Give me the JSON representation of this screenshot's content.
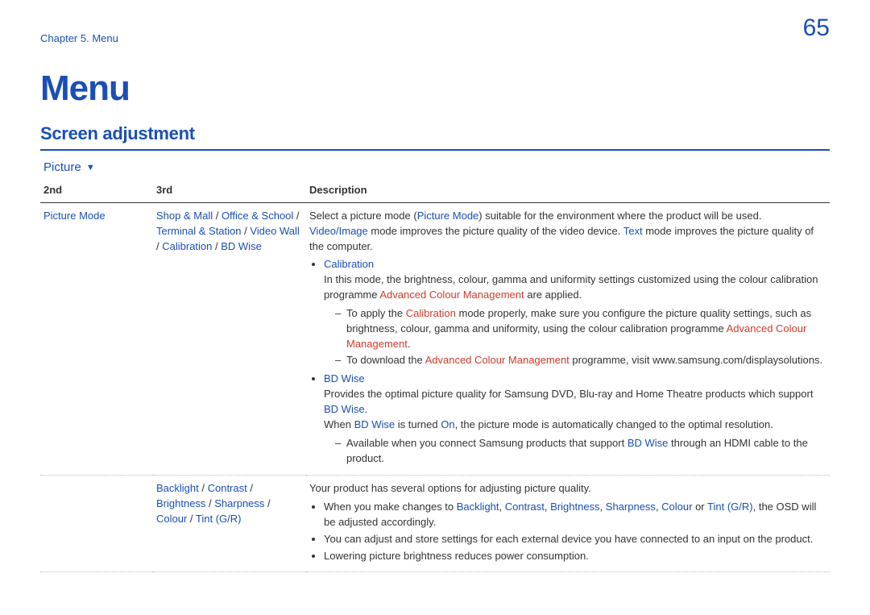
{
  "header": {
    "chapter": "Chapter 5. Menu",
    "page_number": "65"
  },
  "title": "Menu",
  "section": "Screen adjustment",
  "dropdown": "Picture",
  "table": {
    "headers": {
      "c1": "2nd",
      "c2": "3rd",
      "c3": "Description"
    }
  },
  "row1": {
    "c1": "Picture Mode",
    "c2": {
      "opt1": "Shop & Mall",
      "opt2": "Office & School",
      "opt3": "Terminal & Station",
      "opt4": "Video Wall",
      "opt5": "Calibration",
      "opt6": "BD Wise"
    },
    "desc": {
      "p1_a": "Select a picture mode (",
      "p1_b": "Picture Mode",
      "p1_c": ") suitable for the environment where the product will be used.",
      "p2_a": "Video/Image",
      "p2_b": " mode improves the picture quality of the video device. ",
      "p2_c": "Text",
      "p2_d": " mode improves the picture quality of the computer.",
      "b1_title": "Calibration",
      "b1_p_a": "In this mode, the brightness, colour, gamma and uniformity settings customized using the colour calibration programme ",
      "b1_p_b": "Advanced Colour Management",
      "b1_p_c": " are applied.",
      "b1_d1_a": "To apply the ",
      "b1_d1_b": "Calibration",
      "b1_d1_c": " mode properly, make sure you configure the picture quality settings, such as brightness, colour, gamma and uniformity, using the colour calibration programme ",
      "b1_d1_d": "Advanced Colour Management",
      "b1_d1_e": ".",
      "b1_d2_a": "To download the ",
      "b1_d2_b": "Advanced Colour Management",
      "b1_d2_c": " programme, visit www.samsung.com/displaysolutions.",
      "b2_title": "BD Wise",
      "b2_p1_a": "Provides the optimal picture quality for Samsung DVD, Blu-ray and Home Theatre products which support ",
      "b2_p1_b": "BD Wise",
      "b2_p1_c": ".",
      "b2_p2_a": "When ",
      "b2_p2_b": "BD Wise",
      "b2_p2_c": " is turned ",
      "b2_p2_d": "On",
      "b2_p2_e": ", the picture mode is automatically changed to the optimal resolution.",
      "b2_d1_a": "Available when you connect Samsung products that support ",
      "b2_d1_b": "BD Wise",
      "b2_d1_c": " through an HDMI cable to the product."
    }
  },
  "row2": {
    "c2": {
      "opt1": "Backlight",
      "opt2": "Contrast",
      "opt3": "Brightness",
      "opt4": "Sharpness",
      "opt5": "Colour",
      "opt6": "Tint (G/R)"
    },
    "desc": {
      "p1": "Your product has several options for adjusting picture quality.",
      "b1_a": "When you make changes to ",
      "b1_b": "Backlight",
      "b1_c": ", ",
      "b1_d": "Contrast",
      "b1_e": ", ",
      "b1_f": "Brightness",
      "b1_g": ", ",
      "b1_h": "Sharpness",
      "b1_i": ", ",
      "b1_j": "Colour",
      "b1_k": " or ",
      "b1_l": "Tint (G/R)",
      "b1_m": ", the OSD will be adjusted accordingly.",
      "b2": "You can adjust and store settings for each external device you have connected to an input on the product.",
      "b3": "Lowering picture brightness reduces power consumption."
    }
  },
  "sep": " / "
}
